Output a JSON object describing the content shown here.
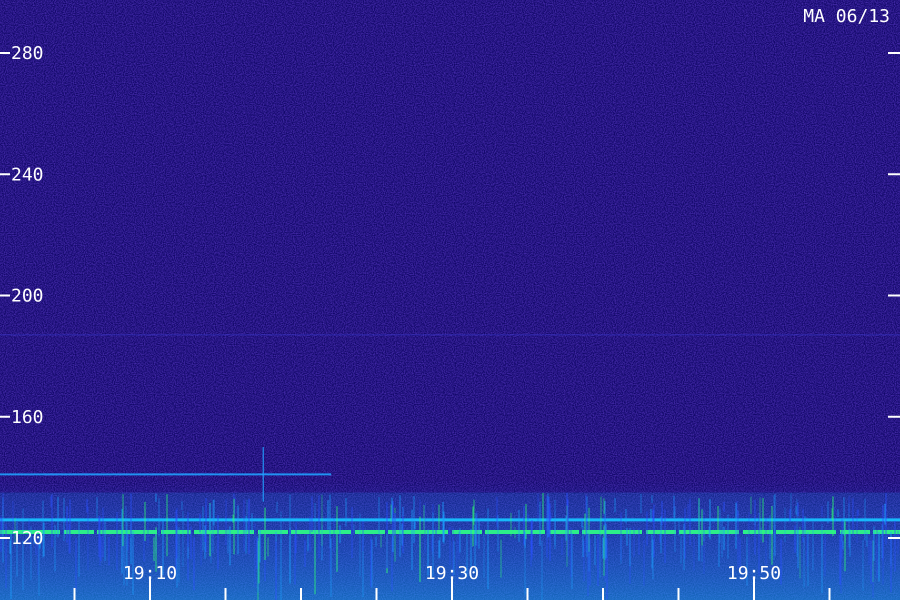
{
  "chart_data": {
    "type": "heatmap",
    "title": "MA 06/13",
    "xlabel": "",
    "ylabel": "",
    "x_tick_labels": [
      "19:10",
      "19:30",
      "19:50"
    ],
    "y_tick_labels": [
      "280",
      "240",
      "200",
      "160",
      "120"
    ],
    "x_range_minutes": [
      "19:00",
      "20:00"
    ],
    "y_range": [
      110,
      300
    ],
    "colors": {
      "background": "#12086a",
      "noise_dark": "#050230",
      "noise_mid": "#2a10b0",
      "noise_bright": "#4a30e0",
      "band_cyan": "#1aa0ff",
      "band_green": "#2cff70",
      "text": "#ffffff",
      "tick": "#ffffff"
    },
    "features": [
      {
        "kind": "horizontal_line",
        "y": 187,
        "from": "19:00",
        "to": "20:00",
        "intensity": "faint"
      },
      {
        "kind": "horizontal_line",
        "y": 141,
        "from": "19:00",
        "to": "19:22",
        "intensity": "medium"
      },
      {
        "kind": "vertical_line",
        "x": "19:17.5",
        "y_from": 132,
        "y_to": 150,
        "intensity": "medium"
      },
      {
        "kind": "horizontal_line",
        "y": 126,
        "from": "19:00",
        "to": "20:00",
        "intensity": "strong"
      },
      {
        "kind": "horizontal_line",
        "y": 122,
        "from": "19:00",
        "to": "20:00",
        "intensity": "strongest"
      },
      {
        "kind": "band",
        "y_from": 110,
        "y_to": 135,
        "from": "19:00",
        "to": "20:00",
        "intensity": "strong"
      }
    ]
  }
}
